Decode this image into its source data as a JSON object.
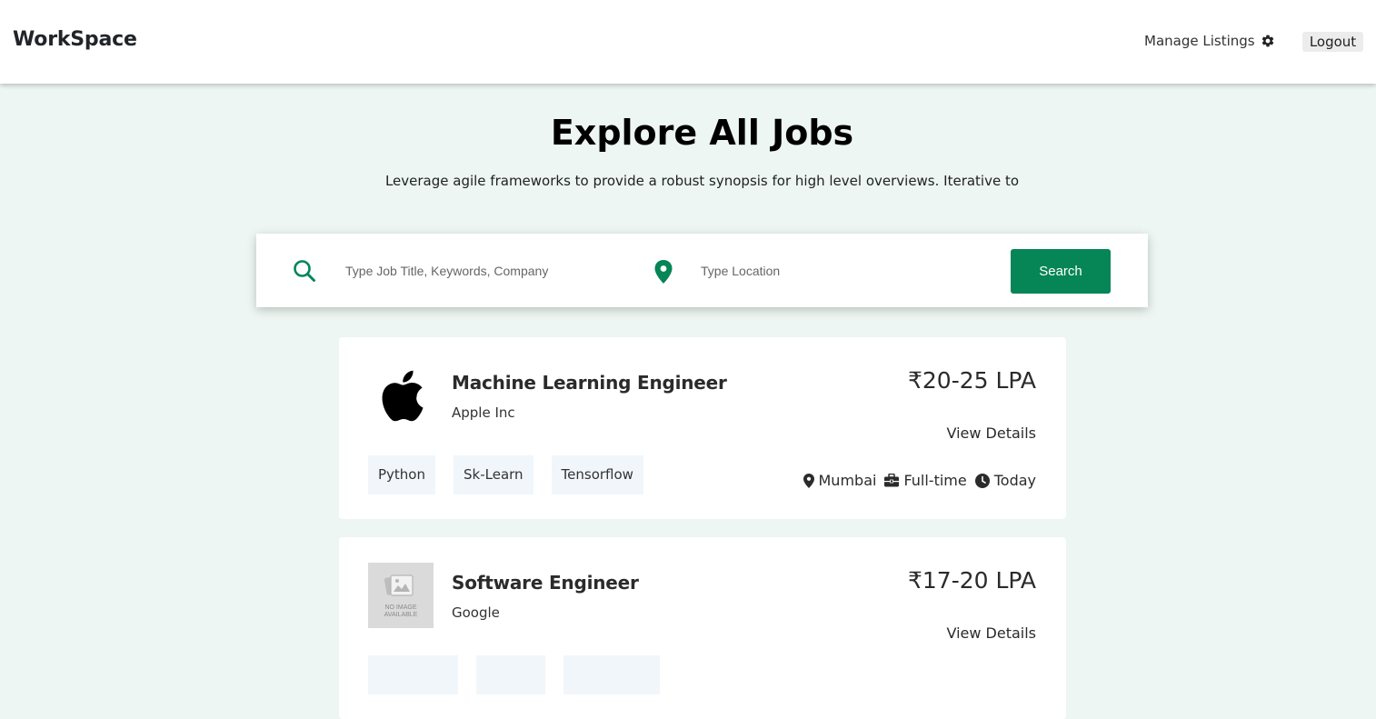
{
  "navbar": {
    "brand": "WorkSpace",
    "manage_listings": "Manage Listings",
    "manage_icon": "gear-icon",
    "logout": "Logout"
  },
  "hero": {
    "title": "Explore All Jobs",
    "subtitle": "Leverage agile frameworks to provide a robust synopsis for high level overviews. Iterative to"
  },
  "search": {
    "job_icon": "search-icon",
    "job_placeholder": "Type Job Title, Keywords, Company",
    "job_value": "",
    "location_icon": "map-pin-icon",
    "location_placeholder": "Type Location",
    "location_value": "",
    "button_label": "Search"
  },
  "colors": {
    "accent": "#068557",
    "page_background": "#edf6f2",
    "tag_background": "#f1f6fa"
  },
  "jobs": [
    {
      "title": "Machine Learning Engineer",
      "company": "Apple Inc",
      "logo": "apple-logo",
      "salary": "₹20-25 LPA",
      "view_details": "View Details",
      "tags": [
        "Python",
        "Sk-Learn",
        "Tensorflow"
      ],
      "location": "Mumbai",
      "job_type": "Full-time",
      "posted": "Today"
    },
    {
      "title": "Software Engineer",
      "company": "Google",
      "logo": "no-image-available",
      "logo_text": [
        "NO IMAGE",
        "AVAILABLE"
      ],
      "salary": "₹17-20 LPA",
      "view_details": "View Details"
    }
  ]
}
